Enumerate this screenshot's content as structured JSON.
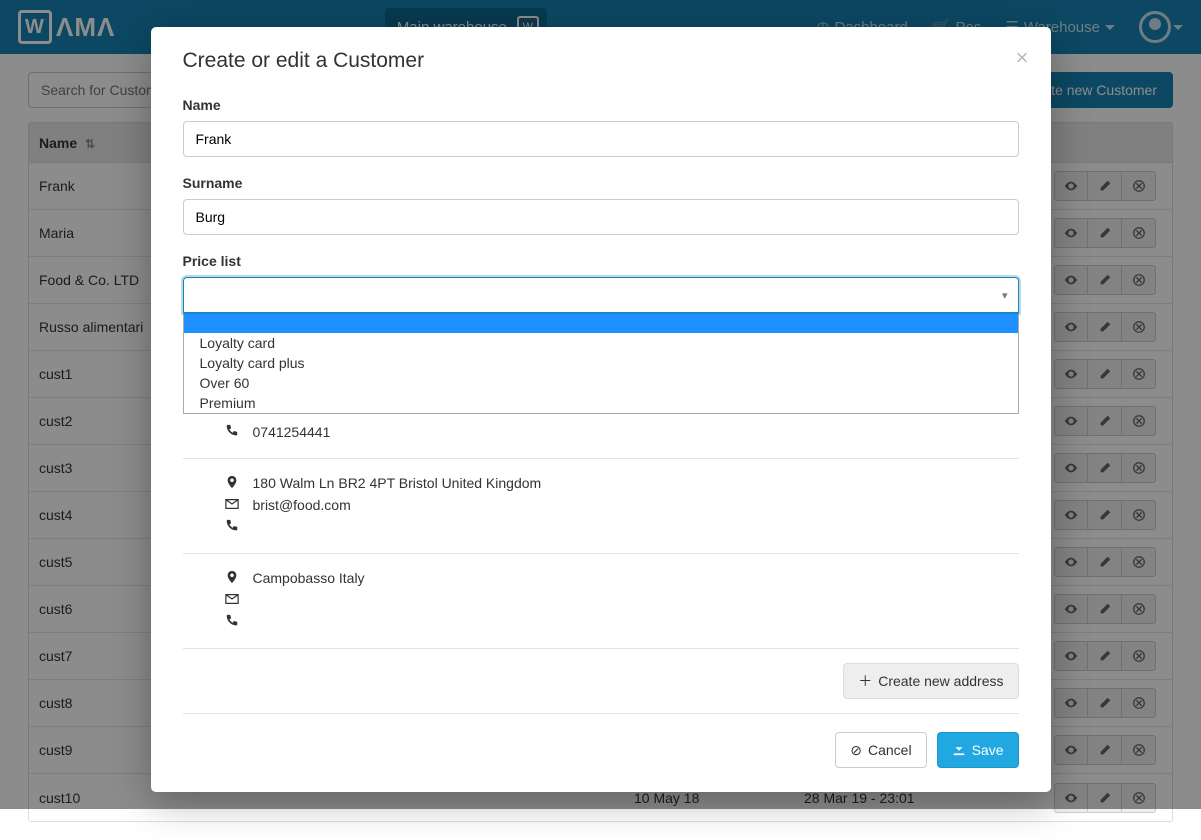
{
  "nav": {
    "logo_text": "WAMA",
    "warehouse_label": "Main warehouse",
    "dashboard": "Dashboard",
    "pos": "Pos",
    "warehouse_menu": "Warehouse"
  },
  "toolbar": {
    "search_placeholder": "Search for Customers",
    "create_button": "Create new Customer"
  },
  "table": {
    "col_name": "Name",
    "col_created": "",
    "col_updated": "",
    "rows": [
      {
        "name": "Frank",
        "created": "",
        "updated": ""
      },
      {
        "name": "Maria",
        "created": "",
        "updated": ""
      },
      {
        "name": "Food & Co. LTD",
        "created": "",
        "updated": ""
      },
      {
        "name": "Russo alimentari",
        "created": "",
        "updated": ""
      },
      {
        "name": "cust1",
        "created": "",
        "updated": ""
      },
      {
        "name": "cust2",
        "created": "",
        "updated": ""
      },
      {
        "name": "cust3",
        "created": "",
        "updated": ""
      },
      {
        "name": "cust4",
        "created": "",
        "updated": ""
      },
      {
        "name": "cust5",
        "created": "",
        "updated": ""
      },
      {
        "name": "cust6",
        "created": "",
        "updated": ""
      },
      {
        "name": "cust7",
        "created": "",
        "updated": ""
      },
      {
        "name": "cust8",
        "created": "",
        "updated": ""
      },
      {
        "name": "cust9",
        "created": "",
        "updated": ""
      },
      {
        "name": "cust10",
        "created": "10 May 18",
        "updated": "28 Mar 19 - 23:01"
      }
    ]
  },
  "modal": {
    "title": "Create or edit a Customer",
    "name_label": "Name",
    "name_value": "Frank",
    "surname_label": "Surname",
    "surname_value": "Burg",
    "pricelist_label": "Price list",
    "pricelist_options": [
      "",
      "Loyalty card",
      "Loyalty card plus",
      "Over 60",
      "Premium"
    ],
    "contact_phone": "0741254441",
    "addresses": [
      {
        "addr": "180 Walm Ln BR2 4PT Bristol United Kingdom",
        "email": "brist@food.com",
        "phone": ""
      },
      {
        "addr": "Campobasso Italy",
        "email": "",
        "phone": ""
      }
    ],
    "create_address": "Create new address",
    "cancel": "Cancel",
    "save": "Save"
  }
}
